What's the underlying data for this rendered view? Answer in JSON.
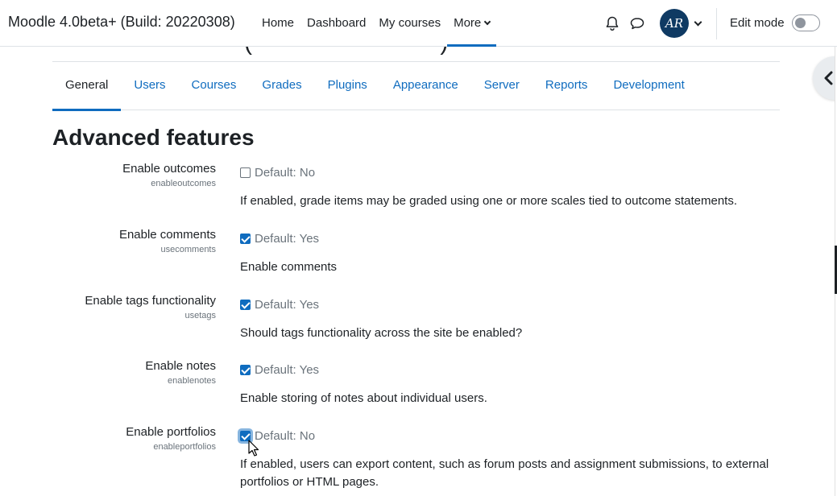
{
  "navbar": {
    "brand": "Moodle 4.0beta+ (Build: 20220308)",
    "links": [
      {
        "label": "Home",
        "active": false
      },
      {
        "label": "Dashboard",
        "active": false
      },
      {
        "label": "My courses",
        "active": false
      },
      {
        "label": "More",
        "active": true
      }
    ],
    "avatar_initials": "AR",
    "edit_mode_label": "Edit mode",
    "edit_mode_on": false,
    "icons": [
      "bell-icon",
      "chat-icon",
      "chevron-down-icon",
      "chevron-left-icon"
    ]
  },
  "tabs": [
    {
      "label": "General",
      "active": true
    },
    {
      "label": "Users"
    },
    {
      "label": "Courses"
    },
    {
      "label": "Grades"
    },
    {
      "label": "Plugins"
    },
    {
      "label": "Appearance"
    },
    {
      "label": "Server"
    },
    {
      "label": "Reports"
    },
    {
      "label": "Development"
    }
  ],
  "page_title": "Advanced features",
  "settings": [
    {
      "title": "Enable outcomes",
      "key": "enableoutcomes",
      "checked": false,
      "default": "Default: No",
      "description": "If enabled, grade items may be graded using one or more scales tied to outcome statements."
    },
    {
      "title": "Enable comments",
      "key": "usecomments",
      "checked": true,
      "default": "Default: Yes",
      "description": "Enable comments"
    },
    {
      "title": "Enable tags functionality",
      "key": "usetags",
      "checked": true,
      "default": "Default: Yes",
      "description": "Should tags functionality across the site be enabled?"
    },
    {
      "title": "Enable notes",
      "key": "enablenotes",
      "checked": true,
      "default": "Default: Yes",
      "description": "Enable storing of notes about individual users."
    },
    {
      "title": "Enable portfolios",
      "key": "enableportfolios",
      "checked": true,
      "default": "Default: No",
      "description": "If enabled, users can export content, such as forum posts and assignment submissions, to external portfolios or HTML pages."
    }
  ],
  "colors": {
    "accent": "#0f6cbf",
    "text": "#1d2125",
    "muted": "#6a737b",
    "avatar_bg": "#0f3a63"
  }
}
